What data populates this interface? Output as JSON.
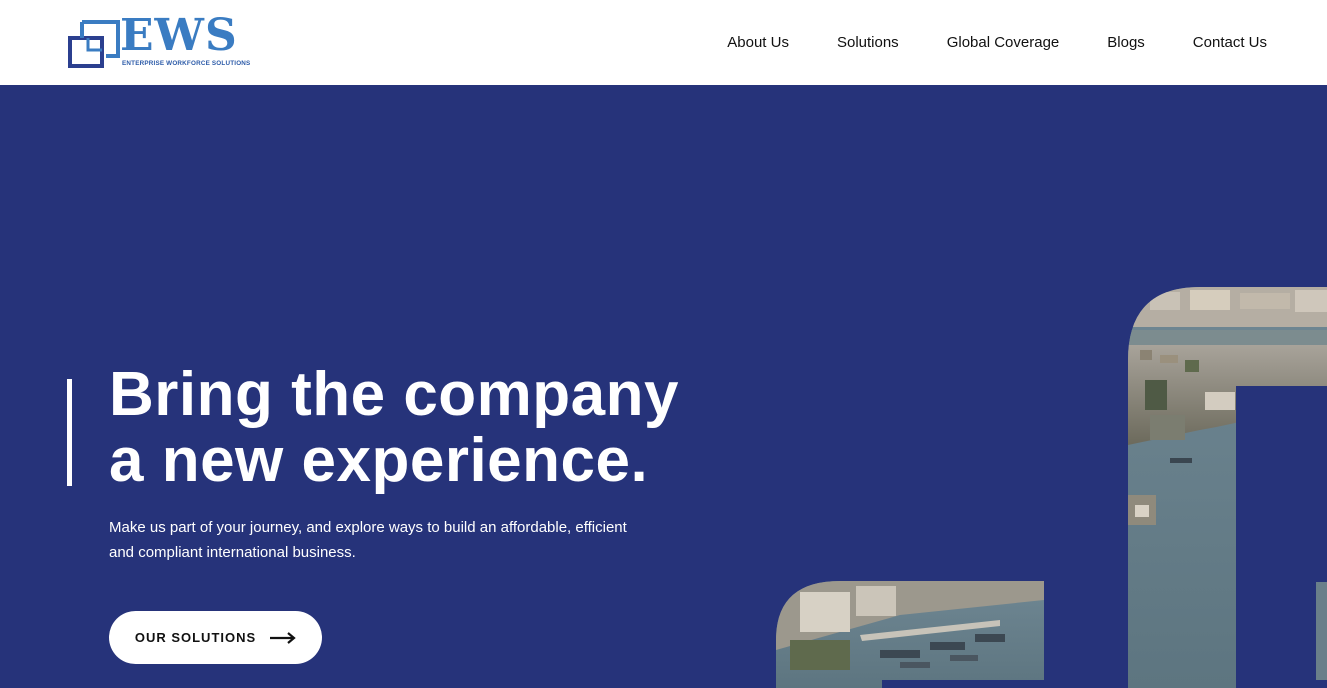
{
  "header": {
    "logo": {
      "wordmark": "EWS",
      "tagline": "ENTERPRISE WORKFORCE SOLUTIONS",
      "colors": {
        "primary": "#3a7cc2",
        "dark": "#2b3f8f"
      }
    },
    "nav": [
      {
        "label": "About Us"
      },
      {
        "label": "Solutions"
      },
      {
        "label": "Global Coverage"
      },
      {
        "label": "Blogs"
      },
      {
        "label": "Contact Us"
      }
    ]
  },
  "hero": {
    "title_line1": "Bring the company",
    "title_line2": "a new experience.",
    "subtitle": "Make us part of your journey, and explore ways to build an affordable, efficient and compliant international business.",
    "cta_label": "OUR SOLUTIONS",
    "cta_icon": "arrow-right-icon",
    "background_color": "#26337a",
    "photos": [
      "city-river-aerial-photo-large",
      "city-river-aerial-photo-small"
    ]
  }
}
